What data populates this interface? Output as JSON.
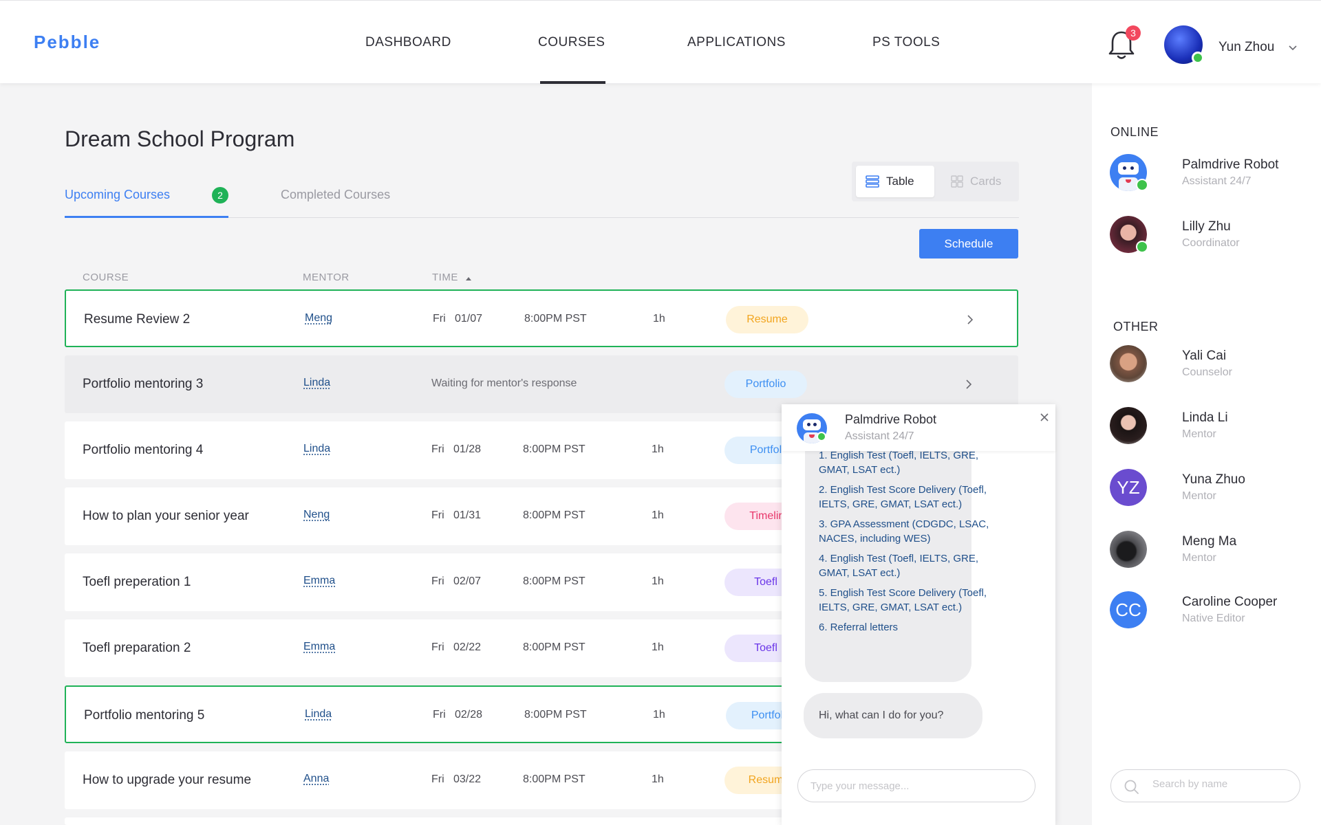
{
  "app": {
    "logo": "Pebble"
  },
  "nav": {
    "items": [
      {
        "label": "DASHBOARD"
      },
      {
        "label": "COURSES",
        "active": true
      },
      {
        "label": "APPLICATIONS"
      },
      {
        "label": "PS TOOLS"
      }
    ],
    "notification_count": "3",
    "user_name": "Yun Zhou"
  },
  "page": {
    "title": "Dream School Program",
    "tabs": {
      "upcoming": "Upcoming Courses",
      "upcoming_count": "2",
      "completed": "Completed Courses"
    },
    "view_toggle": {
      "table": "Table",
      "cards": "Cards",
      "selected": "Table"
    },
    "schedule_label": "Schedule",
    "columns": {
      "course": "COURSE",
      "mentor": "MENTOR",
      "time": "TIME"
    }
  },
  "rows": [
    {
      "course": "Resume Review 2",
      "mentor": "Meng",
      "day": "Fri",
      "date": "01/07",
      "time": "8:00PM PST",
      "duration": "1h",
      "tag": "Resume"
    },
    {
      "course": "Portfolio mentoring 3",
      "mentor": "Linda",
      "status": "Waiting for mentor's response",
      "tag": "Portfolio"
    },
    {
      "course": "Portfolio mentoring 4",
      "mentor": "Linda",
      "day": "Fri",
      "date": "01/28",
      "time": "8:00PM PST",
      "duration": "1h",
      "tag": "Portfol"
    },
    {
      "course": "How to plan your senior year",
      "mentor": "Neng",
      "day": "Fri",
      "date": "01/31",
      "time": "8:00PM PST",
      "duration": "1h",
      "tag": "Timelir"
    },
    {
      "course": "Toefl preperation 1",
      "mentor": "Emma",
      "day": "Fri",
      "date": "02/07",
      "time": "8:00PM PST",
      "duration": "1h",
      "tag": "Toefl"
    },
    {
      "course": "Toefl preparation 2",
      "mentor": "Emma",
      "day": "Fri",
      "date": "02/22",
      "time": "8:00PM PST",
      "duration": "1h",
      "tag": "Toefl"
    },
    {
      "course": "Portfolio mentoring 5",
      "mentor": "Linda",
      "day": "Fri",
      "date": "02/28",
      "time": "8:00PM PST",
      "duration": "1h",
      "tag": "Portfol"
    },
    {
      "course": "How to upgrade your resume",
      "mentor": "Anna",
      "day": "Fri",
      "date": "03/22",
      "time": "8:00PM PST",
      "duration": "1h",
      "tag": "Resum"
    }
  ],
  "chat": {
    "name": "Palmdrive Robot",
    "subtitle": "Assistant 24/7",
    "options": [
      "1. English Test (Toefl, IELTS, GRE, GMAT, LSAT ect.)",
      "2. English Test Score Delivery (Toefl, IELTS, GRE, GMAT, LSAT ect.)",
      "3. GPA Assessment (CDGDC, LSAC, NACES, including WES)",
      "4. English Test (Toefl, IELTS, GRE, GMAT, LSAT ect.)",
      "5. English Test Score Delivery (Toefl, IELTS, GRE, GMAT, LSAT ect.)",
      "6. Referral letters"
    ],
    "greeting": "Hi, what can I do for you?",
    "input_placeholder": "Type your message..."
  },
  "sidebar": {
    "online_title": "ONLINE",
    "other_title": "OTHER",
    "online": [
      {
        "name": "Palmdrive Robot",
        "role": "Assistant 24/7"
      },
      {
        "name": "Lilly Zhu",
        "role": "Coordinator"
      }
    ],
    "other": [
      {
        "name": "Yali Cai",
        "role": "Counselor"
      },
      {
        "name": "Linda Li",
        "role": "Mentor"
      },
      {
        "name": "Yuna Zhuo",
        "role": "Mentor",
        "initials": "YZ"
      },
      {
        "name": "Meng Ma",
        "role": "Mentor"
      },
      {
        "name": "Caroline Cooper",
        "role": "Native Editor",
        "initials": "CC"
      }
    ],
    "search_placeholder": "Search by name"
  },
  "colors": {
    "accent": "#3d7ff2",
    "success": "#1fb257",
    "online": "#3ec24b",
    "badge": "#f2485e",
    "yz_avatar": "#6a4ccf",
    "cc_avatar": "#3d7ff2"
  }
}
